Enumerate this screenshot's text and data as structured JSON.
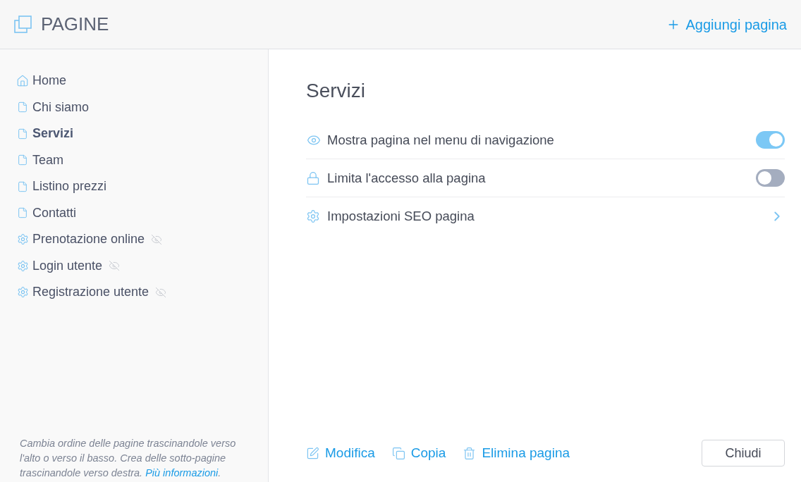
{
  "header": {
    "title": "PAGINE",
    "add_button": "Aggiungi pagina"
  },
  "sidebar": {
    "items": [
      {
        "label": "Home",
        "kind": "home",
        "selected": false,
        "hidden": false
      },
      {
        "label": "Chi siamo",
        "kind": "page",
        "selected": false,
        "hidden": false
      },
      {
        "label": "Servizi",
        "kind": "page",
        "selected": true,
        "hidden": false
      },
      {
        "label": "Team",
        "kind": "page",
        "selected": false,
        "hidden": false
      },
      {
        "label": "Listino prezzi",
        "kind": "page",
        "selected": false,
        "hidden": false
      },
      {
        "label": "Contatti",
        "kind": "page",
        "selected": false,
        "hidden": false
      },
      {
        "label": "Prenotazione online",
        "kind": "system",
        "selected": false,
        "hidden": true
      },
      {
        "label": "Login utente",
        "kind": "system",
        "selected": false,
        "hidden": true
      },
      {
        "label": "Registrazione utente",
        "kind": "system",
        "selected": false,
        "hidden": true
      }
    ],
    "hint": "Cambia ordine delle pagine trascinandole verso l'alto o verso il basso. Crea delle sotto-pagine trascinandole verso destra.",
    "hint_link": "Più informazioni",
    "hint_end": "."
  },
  "detail": {
    "title": "Servizi",
    "settings": [
      {
        "label": "Mostra pagina nel menu di navigazione",
        "kind": "toggle",
        "on": true
      },
      {
        "label": "Limita l'accesso alla pagina",
        "kind": "toggle",
        "on": false
      },
      {
        "label": "Impostazioni SEO pagina",
        "kind": "link"
      }
    ],
    "actions": [
      {
        "label": "Modifica"
      },
      {
        "label": "Copia"
      },
      {
        "label": "Elimina pagina"
      }
    ],
    "close_button": "Chiudi"
  }
}
